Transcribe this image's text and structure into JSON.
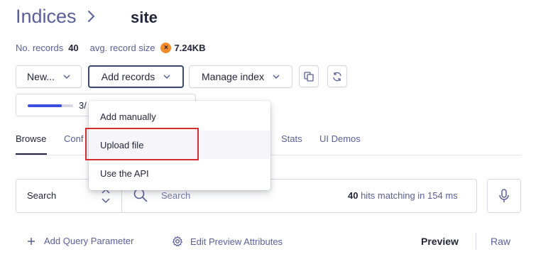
{
  "breadcrumb": {
    "root": "Indices",
    "current": "site"
  },
  "stats": {
    "records_label": "No. records",
    "records_value": "40",
    "size_label": "avg. record size",
    "size_value": "7.24KB",
    "warning_glyph": "×"
  },
  "toolbar": {
    "new_label": "New...",
    "add_records_label": "Add records",
    "manage_index_label": "Manage index",
    "copy_icon": "copy-icon",
    "refresh_icon": "refresh-icon"
  },
  "progress": {
    "text": "3/",
    "fraction": 0.75
  },
  "tabs": [
    "Browse",
    "Conf",
    "Stats",
    "UI Demos"
  ],
  "search": {
    "select_label": "Search",
    "placeholder": "Search",
    "hits_count": "40",
    "hits_text": " hits matching in 154 ms"
  },
  "bottom": {
    "add_param": "Add Query Parameter",
    "edit_attr": "Edit Preview Attributes",
    "preview": "Preview",
    "raw": "Raw"
  },
  "menu": {
    "items": [
      "Add manually",
      "Upload file",
      "Use the API"
    ]
  },
  "colors": {
    "accent": "#3c4fe0",
    "warning": "#f28c2a",
    "highlight": "#d32f2f"
  }
}
